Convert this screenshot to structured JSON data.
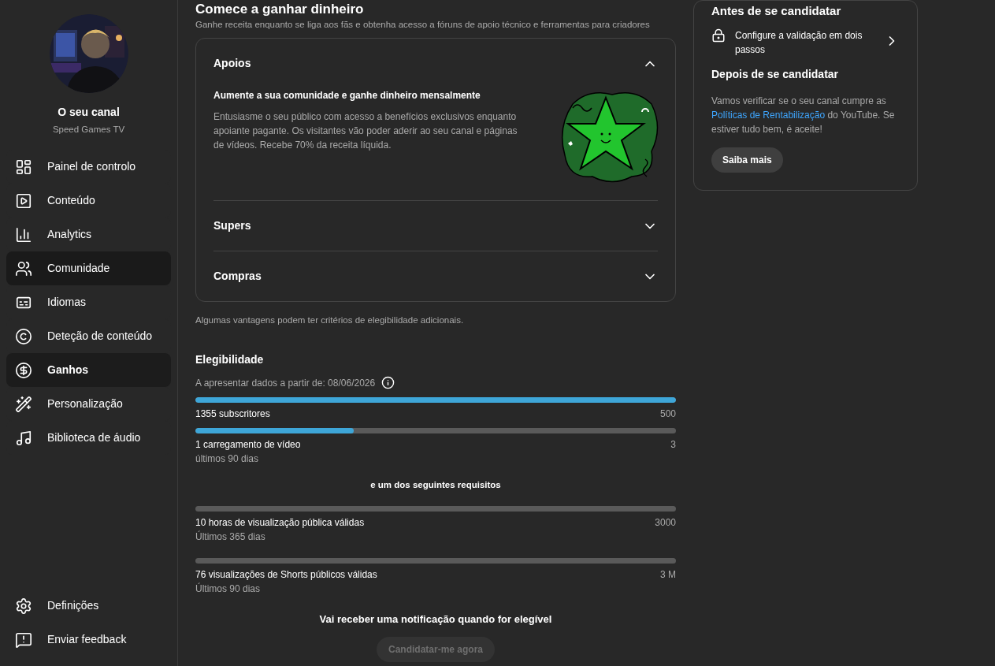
{
  "sidebar": {
    "channel_title": "O seu canal",
    "channel_name": "Speed Games TV",
    "items": [
      {
        "label": "Painel de controlo",
        "selected": false,
        "hovered": false
      },
      {
        "label": "Conteúdo",
        "selected": false,
        "hovered": false
      },
      {
        "label": "Analytics",
        "selected": false,
        "hovered": false
      },
      {
        "label": "Comunidade",
        "selected": false,
        "hovered": true
      },
      {
        "label": "Idiomas",
        "selected": false,
        "hovered": false
      },
      {
        "label": "Deteção de conteúdo",
        "selected": false,
        "hovered": false
      },
      {
        "label": "Ganhos",
        "selected": true,
        "hovered": false
      },
      {
        "label": "Personalização",
        "selected": false,
        "hovered": false
      },
      {
        "label": "Biblioteca de áudio",
        "selected": false,
        "hovered": false
      }
    ],
    "footer_items": [
      {
        "label": "Definições"
      },
      {
        "label": "Enviar feedback"
      }
    ]
  },
  "main": {
    "title": "Comece a ganhar dinheiro",
    "subtitle": "Ganhe receita enquanto se liga aos fãs e obtenha acesso a fóruns de apoio técnico e ferramentas para criadores",
    "accordion": [
      {
        "title": "Apoios",
        "expanded": true,
        "heading": "Aumente a sua comunidade e ganhe dinheiro mensalmente",
        "body": "Entusiasme o seu público com acesso a benefícios exclusivos enquanto apoiante pagante. Os visitantes vão poder aderir ao seu canal e páginas de vídeos. Recebe 70% da receita líquida."
      },
      {
        "title": "Supers",
        "expanded": false
      },
      {
        "title": "Compras",
        "expanded": false
      }
    ],
    "note": "Algumas vantagens podem ter critérios de elegibilidade adicionais.",
    "eligibility": {
      "title": "Elegibilidade",
      "date_label": "A apresentar dados a partir de: 08/06/2026",
      "required": [
        {
          "label": "1355 subscritores",
          "target": "500",
          "level": 1
        },
        {
          "label": "1 carregamento de vídeo",
          "period": "últimos 90 dias",
          "target": "3",
          "level": 0.33
        }
      ],
      "separator": "e um dos seguintes requisitos",
      "optional": [
        {
          "label": "10 horas de visualização pública válidas",
          "period": "Últimos 365 dias",
          "target": "3000",
          "level": 0
        },
        {
          "label": "76 visualizações de Shorts públicos válidas",
          "period": "Últimos 90 dias",
          "target": "3 M",
          "level": 0
        }
      ],
      "notice": "Vai receber uma notificação quando for elegível",
      "apply_button": {
        "label": "Candidatar-me agora",
        "disabled": true
      }
    }
  },
  "side_card": {
    "title": "Antes de se candidatar",
    "step": "Configure a validação em dois passos",
    "after_title": "Depois de se candidatar",
    "after_text_before": "Vamos verificar se o seu canal cumpre as",
    "after_link": "Políticas de Rentabilização",
    "after_text_after": "do YouTube. Se estiver tudo bem, é aceite!",
    "button": "Saiba mais"
  }
}
